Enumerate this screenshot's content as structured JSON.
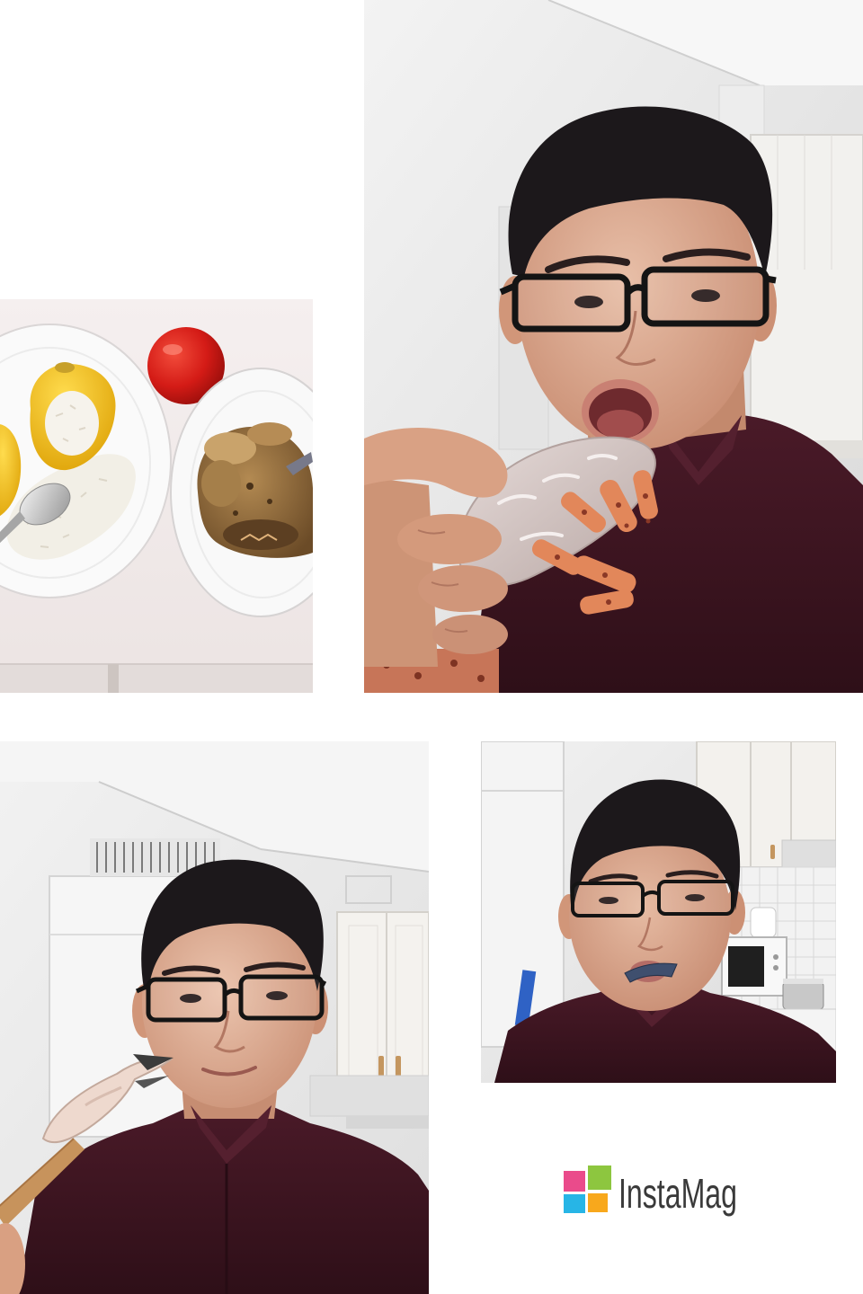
{
  "watermark": {
    "text": "InstaMag",
    "text_color": "#3a3a3a",
    "icon": "instamag-logo-icon",
    "icon_colors": {
      "top_left": "#ea4b8b",
      "top_right": "#8dc63f",
      "bottom_left": "#27b5e6",
      "bottom_right": "#f8a81c"
    }
  }
}
